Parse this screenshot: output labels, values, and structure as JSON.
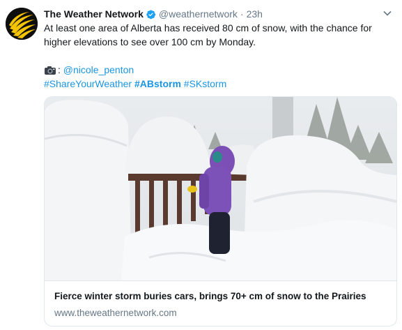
{
  "tweet": {
    "author_name": "The Weather Network",
    "handle": "@weathernetwork",
    "separator": "·",
    "time": "23h",
    "text_line1": "At least one area of Alberta has received 80 cm of snow, with the chance for",
    "text_line2": "higher elevations to see over 100 cm by Monday.",
    "photo_credit_prefix": ":",
    "photo_credit_user": "@nicole_penton",
    "hashtags": [
      "#ShareYourWeather",
      "#ABstorm",
      "#SKstorm"
    ]
  },
  "card": {
    "title": "Fierce winter storm buries cars, brings 70+ cm of snow to the Prairies",
    "domain": "www.theweathernetwork.com"
  },
  "icons": {
    "avatar": "weather-network-logo",
    "verified": "verified-badge-icon",
    "menu": "chevron-down-icon",
    "camera": "camera-emoji-icon"
  },
  "colors": {
    "link": "#1b95e0",
    "muted": "#657786",
    "logo_yellow": "#f5c400"
  }
}
